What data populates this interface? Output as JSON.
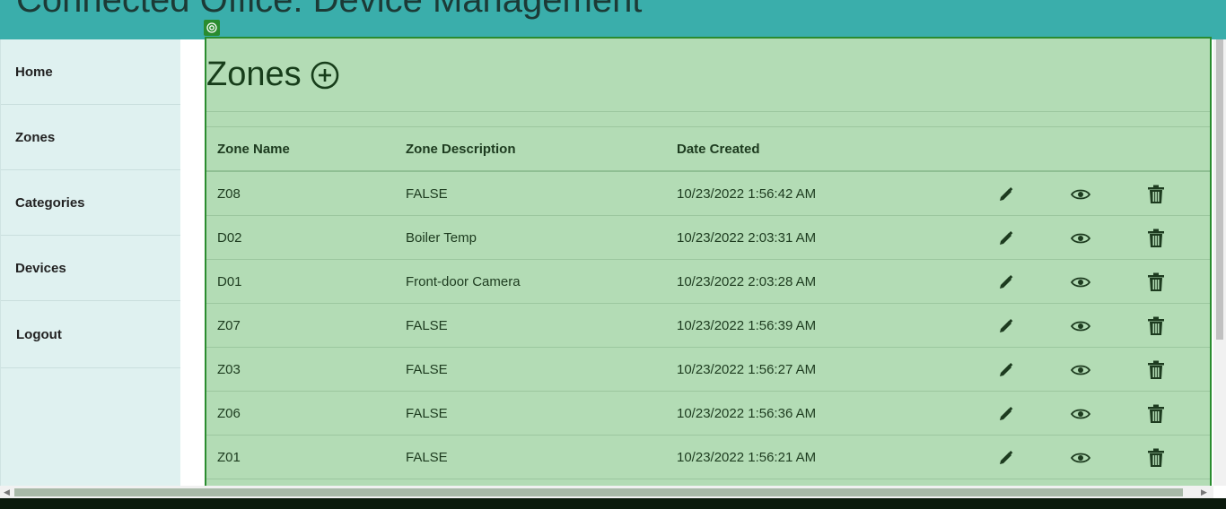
{
  "header": {
    "title": "Connected Office: Device Management"
  },
  "sidebar": {
    "items": [
      {
        "label": "Home"
      },
      {
        "label": "Zones"
      },
      {
        "label": "Categories"
      },
      {
        "label": "Devices"
      },
      {
        "label": "Logout"
      }
    ]
  },
  "page": {
    "title": "Zones",
    "add_icon": "plus-circle-icon"
  },
  "table": {
    "headers": [
      "Zone Name",
      "Zone Description",
      "Date Created"
    ],
    "rows": [
      {
        "name": "Z08",
        "description": "FALSE",
        "created": "10/23/2022 1:56:42 AM"
      },
      {
        "name": "D02",
        "description": "Boiler Temp",
        "created": "10/23/2022 2:03:31 AM"
      },
      {
        "name": "D01",
        "description": "Front-door Camera",
        "created": "10/23/2022 2:03:28 AM"
      },
      {
        "name": "Z07",
        "description": "FALSE",
        "created": "10/23/2022 1:56:39 AM"
      },
      {
        "name": "Z03",
        "description": "FALSE",
        "created": "10/23/2022 1:56:27 AM"
      },
      {
        "name": "Z06",
        "description": "FALSE",
        "created": "10/23/2022 1:56:36 AM"
      },
      {
        "name": "Z01",
        "description": "FALSE",
        "created": "10/23/2022 1:56:21 AM"
      }
    ],
    "row_icons": [
      "pencil-icon",
      "eye-icon",
      "trash-icon"
    ]
  },
  "colors": {
    "header_bg": "#3aaeab",
    "sidebar_bg": "#dff1f0",
    "overlay_bg": "#b3dcb5",
    "overlay_border": "#2a8c2f",
    "text_dark_green": "#1d3b1f"
  }
}
